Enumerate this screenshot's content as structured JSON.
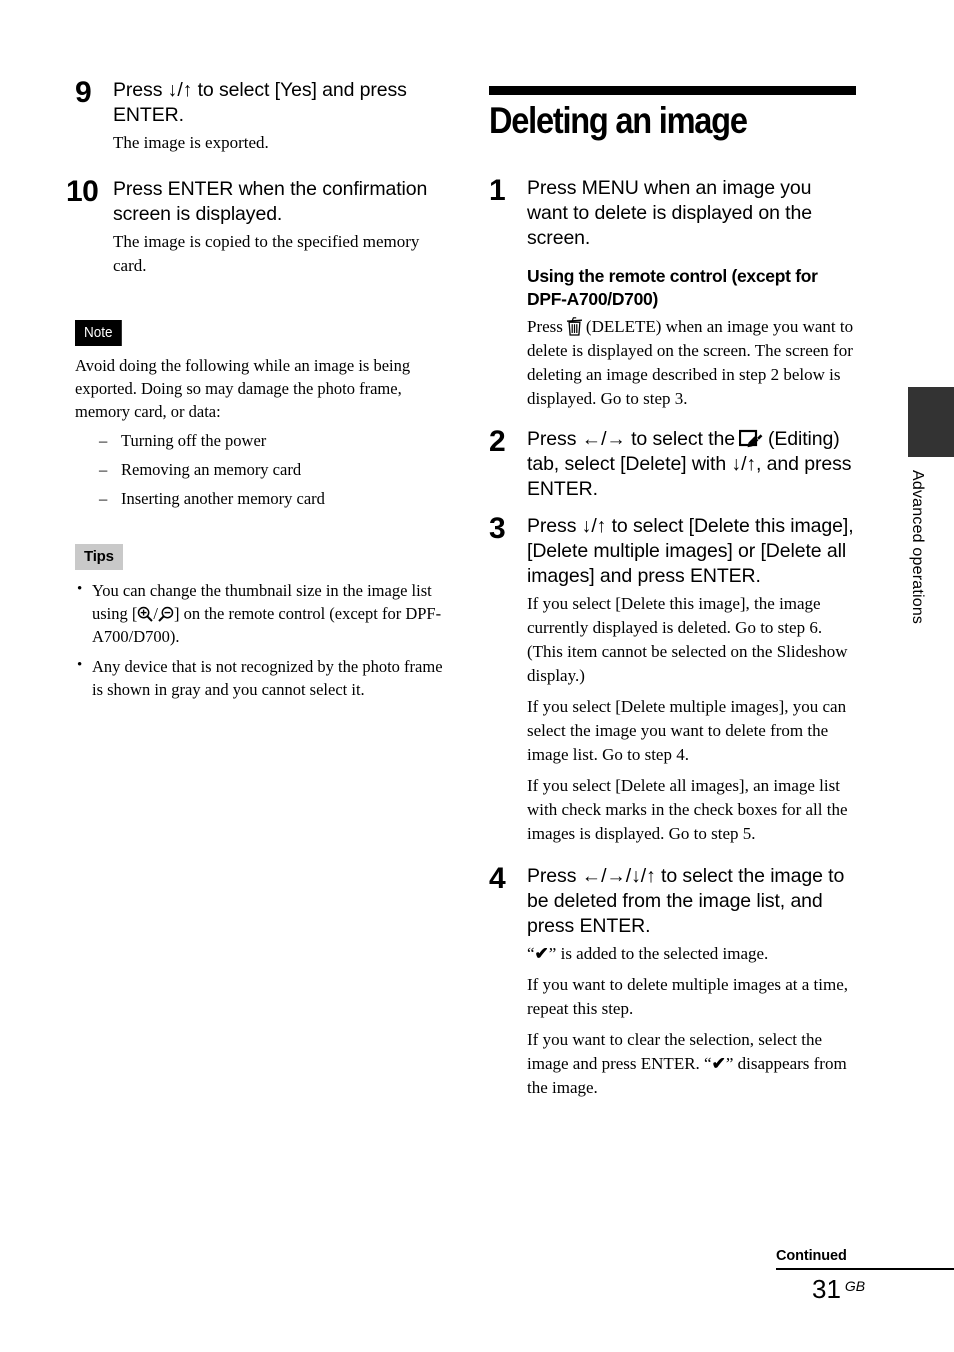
{
  "document": {
    "page_number": "31",
    "page_region": "GB",
    "continued_label": "Continued",
    "side_tab_label": "Advanced operations"
  },
  "left_column": {
    "steps": [
      {
        "number": "9",
        "instruction": "Press ↓/↑ to select [Yes] and press ENTER.",
        "details": [
          "The image is exported."
        ]
      },
      {
        "number": "10",
        "instruction": "Press ENTER when the confirmation screen is displayed.",
        "details": [
          "The image is copied to the specified memory card."
        ]
      }
    ],
    "note": {
      "badge": "Note",
      "body": "Avoid doing the following while an image is being exported. Doing so may damage the photo frame, memory card, or data:",
      "items": [
        "Turning off the power",
        "Removing an memory card",
        "Inserting another memory card"
      ]
    },
    "tips": {
      "badge": "Tips",
      "items_part1": [
        "You can change the thumbnail size in the image list using [",
        "Any device that is not recognized by the photo frame is shown in gray and you cannot select it."
      ],
      "item1_part2": "] on the remote control (except for DPF-A700/D700)."
    }
  },
  "right_column": {
    "section_title": "Deleting an image",
    "steps": [
      {
        "number": "1",
        "instruction": "Press MENU when an image you want to delete is displayed on the screen."
      },
      {
        "number": "2",
        "instruction_part1": "Press ←/→ to select the",
        "instruction_part2": "(Editing) tab, select [Delete] with ↓/↑, and press ENTER."
      },
      {
        "number": "3",
        "instruction": "Press ↓/↑ to select [Delete this image], [Delete multiple images] or [Delete all images] and press ENTER.",
        "details": [
          "If you select [Delete this image], the image currently displayed is deleted. Go to step 6. (This item cannot be selected on the Slideshow display.)",
          "If you select [Delete multiple images], you can select the image you want to delete from the image list. Go to step 4.",
          "If you select [Delete all images], an image list with check marks in the check boxes for all the images is displayed. Go to step 5."
        ]
      },
      {
        "number": "4",
        "instruction": "Press ←/→/↓/↑ to select the image to be deleted from the image list, and press ENTER.",
        "detail1_part1": "“",
        "detail1_part2": "” is added to the selected image.",
        "details": [
          "If you want to delete multiple images at a time, repeat this step."
        ],
        "detail3_part1": "If you want to clear the selection, select the image and press ENTER. “",
        "detail3_part2": "” disappears from the image."
      }
    ],
    "remote_section": {
      "heading": "Using the remote control (except for DPF-A700/D700)",
      "body_part1": "Press",
      "body_part2": "(DELETE) when an image you want to delete is displayed on the screen. The screen for deleting an image described in step 2 below is displayed. Go to step 3."
    }
  },
  "icons": {
    "trash": "trash-icon",
    "editing": "editing-tab-icon",
    "zoom_in": "magnifier-plus-icon",
    "zoom_out": "magnifier-minus-icon",
    "check": "✔"
  }
}
